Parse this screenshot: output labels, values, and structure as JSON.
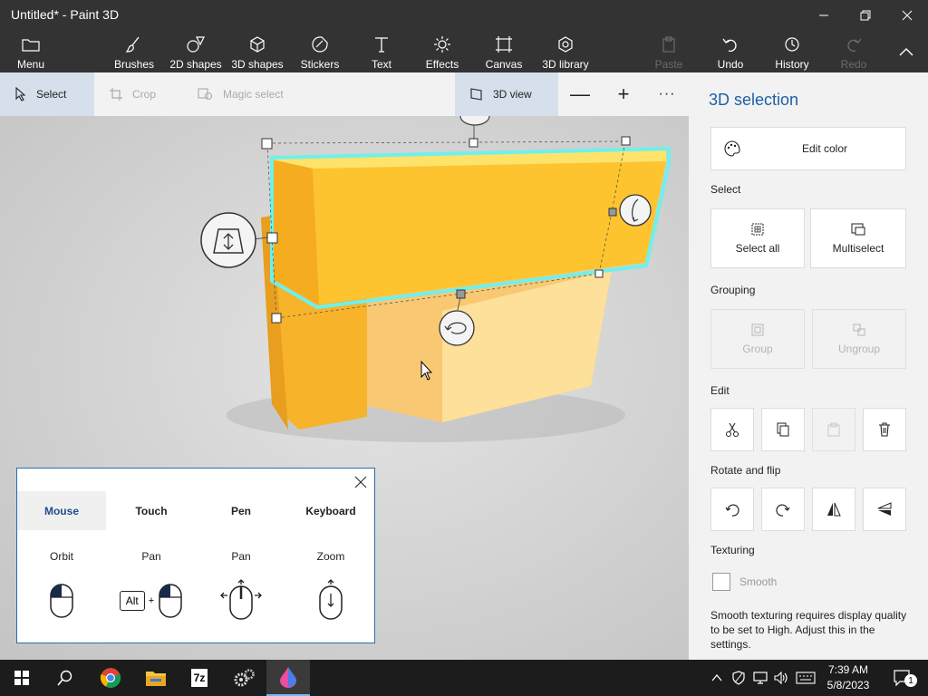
{
  "window": {
    "title": "Untitled* - Paint 3D"
  },
  "ribbon": {
    "menu": "Menu",
    "brushes": "Brushes",
    "shapes2d": "2D shapes",
    "shapes3d": "3D shapes",
    "stickers": "Stickers",
    "text": "Text",
    "effects": "Effects",
    "canvas": "Canvas",
    "library3d": "3D library",
    "paste": "Paste",
    "undo": "Undo",
    "history": "History",
    "redo": "Redo"
  },
  "toolbar": {
    "select": "Select",
    "crop": "Crop",
    "magic_select": "Magic select",
    "view3d": "3D view",
    "zoom_out": "—",
    "zoom_in": "+",
    "more": "···"
  },
  "help": {
    "tabs": [
      "Mouse",
      "Touch",
      "Pen",
      "Keyboard"
    ],
    "active_tab": "Mouse",
    "actions": [
      "Orbit",
      "Pan",
      "Pan",
      "Zoom"
    ],
    "alt_key": "Alt",
    "plus": "+"
  },
  "panel": {
    "title": "3D selection",
    "edit_color": "Edit color",
    "select_section": "Select",
    "select_all": "Select all",
    "multiselect": "Multiselect",
    "grouping_section": "Grouping",
    "group": "Group",
    "ungroup": "Ungroup",
    "edit_section": "Edit",
    "rotate_section": "Rotate and flip",
    "texturing_section": "Texturing",
    "smooth": "Smooth",
    "smooth_note": "Smooth texturing requires display quality to be set to High. Adjust this in the settings."
  },
  "taskbar": {
    "time": "7:39 AM",
    "date": "5/8/2023",
    "notification_count": "1",
    "sevenzip_label": "7z"
  },
  "colors": {
    "accent": "#1f5fa8",
    "shape_orange": "#fdb92b",
    "selection_glow": "#6ff0ec"
  }
}
